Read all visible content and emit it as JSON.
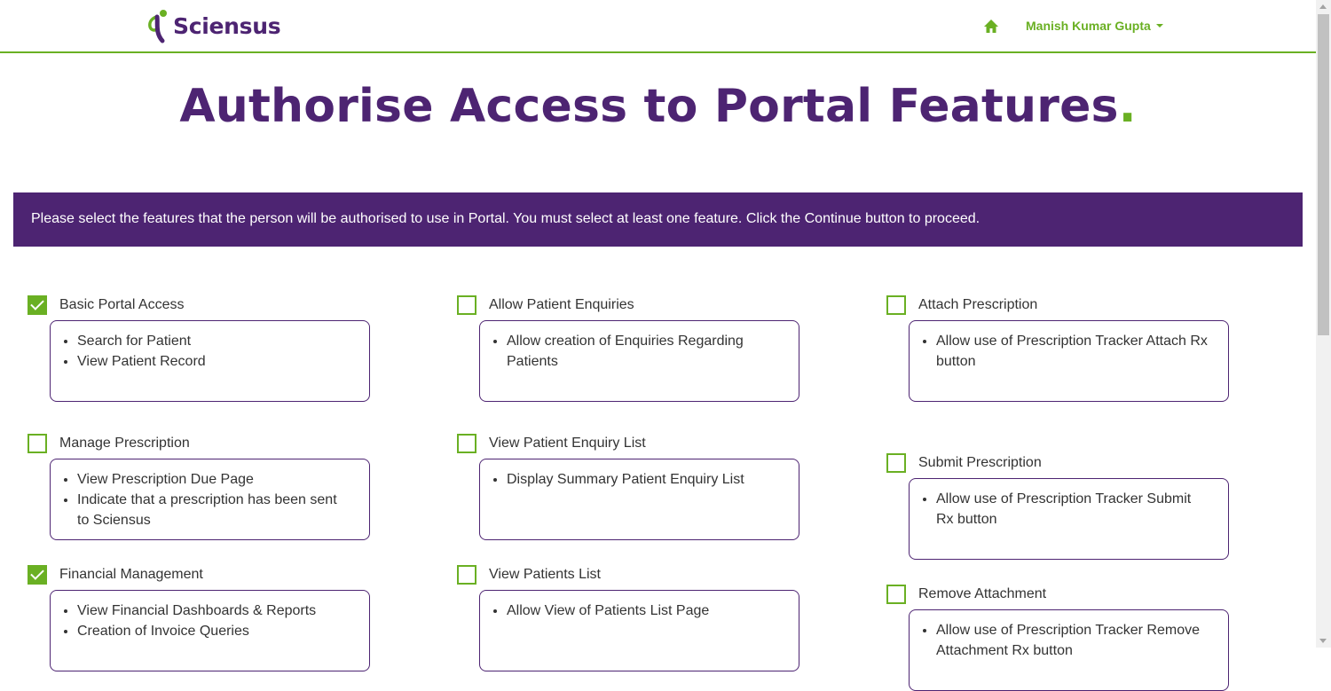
{
  "brand": {
    "name": "Sciensus",
    "primary_color": "#4d2472",
    "accent_color": "#6ab023"
  },
  "nav": {
    "home_icon": "home-icon",
    "user_name": "Manish Kumar Gupta"
  },
  "page": {
    "title": "Authorise Access to Portal Features",
    "title_dot": ".",
    "instructions": "Please select the features that the person will be authorised to use in Portal. You must select at least one feature. Click the Continue button to proceed."
  },
  "features": [
    {
      "name": "Basic Portal Access",
      "checked": true,
      "items": [
        "Search for Patient",
        "View Patient Record"
      ]
    },
    {
      "name": "Allow Patient Enquiries",
      "checked": false,
      "items": [
        "Allow creation of Enquiries Regarding Patients"
      ]
    },
    {
      "name": "Attach Prescription",
      "checked": false,
      "items": [
        "Allow use of Prescription Tracker Attach Rx button"
      ]
    },
    {
      "name": "Manage Prescription",
      "checked": false,
      "items": [
        "View Prescription Due Page",
        "Indicate that a prescription has been sent to Sciensus"
      ]
    },
    {
      "name": "View Patient Enquiry List",
      "checked": false,
      "items": [
        "Display Summary Patient Enquiry List"
      ]
    },
    {
      "name": "Submit Prescription",
      "checked": false,
      "items": [
        "Allow use of Prescription Tracker Submit Rx button"
      ]
    },
    {
      "name": "Financial Management",
      "checked": true,
      "items": [
        "View Financial Dashboards & Reports",
        "Creation of Invoice Queries"
      ]
    },
    {
      "name": "View Patients List",
      "checked": false,
      "items": [
        "Allow View of Patients List Page"
      ]
    },
    {
      "name": "Remove Attachment",
      "checked": false,
      "items": [
        "Allow use of Prescription Tracker Remove Attachment Rx button"
      ]
    }
  ]
}
